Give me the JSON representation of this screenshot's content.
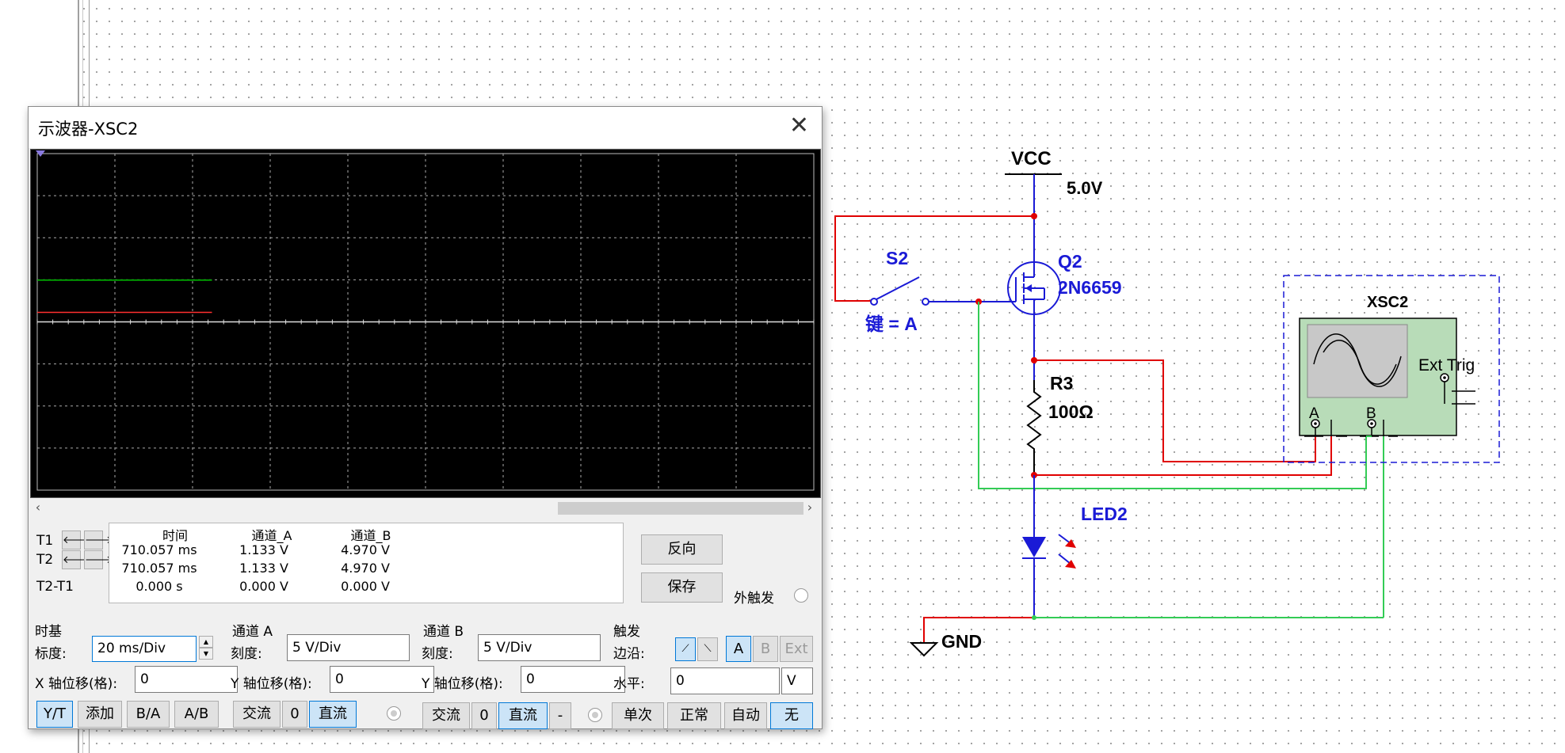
{
  "window": {
    "title": "示波器-XSC2"
  },
  "cursors": {
    "header": {
      "time": "时间",
      "channel_a": "通道_A",
      "channel_b": "通道_B"
    },
    "rows": [
      {
        "label": "T1",
        "time": "710.057 ms",
        "a": "1.133 V",
        "b": "4.970 V"
      },
      {
        "label": "T2",
        "time": "710.057 ms",
        "a": "1.133 V",
        "b": "4.970 V"
      },
      {
        "label": "T2-T1",
        "time": "0.000 s",
        "a": "0.000 V",
        "b": "0.000 V"
      }
    ]
  },
  "actions": {
    "reverse": "反向",
    "save": "保存",
    "ext_trigger": "外触发"
  },
  "timebase": {
    "title": "时基",
    "scale_label": "标度:",
    "scale_value": "20 ms/Div",
    "xpos_label": "X 轴位移(格):",
    "xpos_value": "0",
    "modes": [
      "Y/T",
      "添加",
      "B/A",
      "A/B"
    ]
  },
  "channel_a": {
    "title": "通道 A",
    "scale_label": "刻度:",
    "scale_value": "5  V/Div",
    "ypos_label": "Y 轴位移(格):",
    "ypos_value": "0",
    "coupling": [
      "交流",
      "0",
      "直流"
    ]
  },
  "channel_b": {
    "title": "通道 B",
    "scale_label": "刻度:",
    "scale_value": "5  V/Div",
    "ypos_label": "Y 轴位移(格):",
    "ypos_value": "0",
    "coupling": [
      "交流",
      "0",
      "直流",
      "-"
    ]
  },
  "trigger": {
    "title": "触发",
    "edge_label": "边沿:",
    "source_buttons": [
      "A",
      "B",
      "Ext"
    ],
    "level_label": "水平:",
    "level_value": "0",
    "level_unit": "V",
    "modes": [
      "单次",
      "正常",
      "自动",
      "无"
    ]
  },
  "traces": {
    "channel_a_color": "#ff3030",
    "channel_b_color": "#00c000",
    "channel_a_value_v": 1.133,
    "channel_b_value_v": 4.97,
    "volts_per_div": 5
  },
  "circuit": {
    "vcc_label": "VCC",
    "vcc_value": "5.0V",
    "switch_name": "S2",
    "switch_key": "键 = A",
    "mosfet_name": "Q2",
    "mosfet_model": "2N6659",
    "resistor_name": "R3",
    "resistor_value": "100Ω",
    "led_name": "LED2",
    "gnd_label": "GND",
    "scope_name": "XSC2",
    "scope_ext_trig": "Ext Trig",
    "scope_a": "A",
    "scope_b": "B",
    "wire_red": "#e00000",
    "wire_green": "#33cc55",
    "label_blue": "#1a1ad6"
  }
}
